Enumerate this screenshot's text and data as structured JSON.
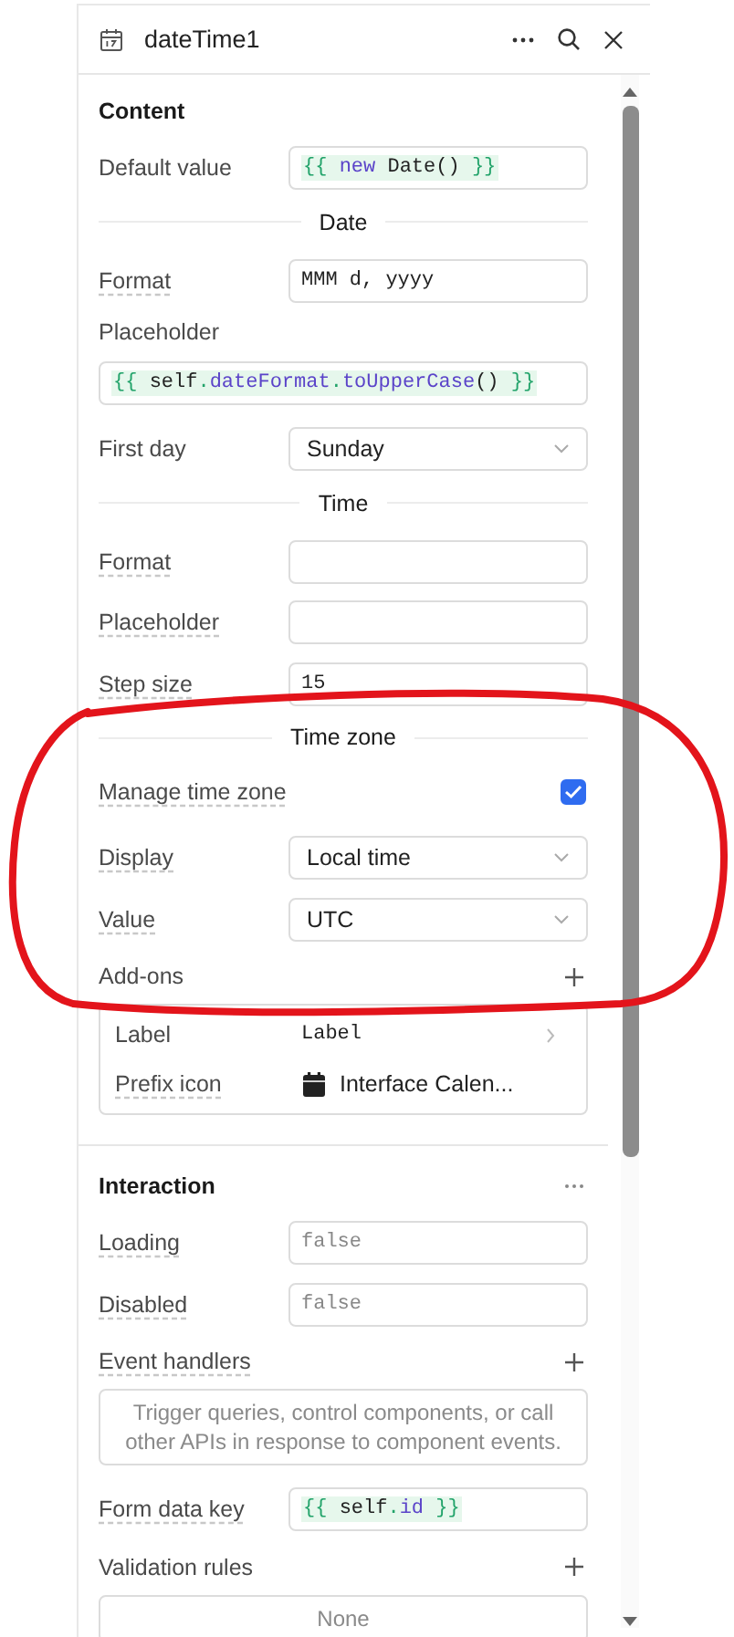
{
  "header": {
    "title": "dateTime1"
  },
  "sections": [
    {
      "title": "Content",
      "menu": false,
      "rows": [
        {
          "kind": "code",
          "label": "Default value",
          "tooltip": false,
          "tokens": [
            {
              "text": "{{ ",
              "kind": "brace"
            },
            {
              "text": "new",
              "kind": "keyword"
            },
            {
              "text": " Date() ",
              "kind": "plain"
            },
            {
              "text": "}}",
              "kind": "brace"
            }
          ]
        },
        {
          "kind": "divider",
          "text": "Date"
        },
        {
          "kind": "input",
          "label": "Format",
          "tooltip": true,
          "value": "MMM d, yyyy"
        },
        {
          "kind": "code_stacked",
          "label": "Placeholder",
          "tooltip": false,
          "tokens": [
            {
              "text": "{{ ",
              "kind": "brace"
            },
            {
              "text": "self",
              "kind": "plain"
            },
            {
              "text": ".",
              "kind": "brace"
            },
            {
              "text": "dateFormat",
              "kind": "keyword"
            },
            {
              "text": ".",
              "kind": "brace"
            },
            {
              "text": "toUpperCase",
              "kind": "keyword"
            },
            {
              "text": "() ",
              "kind": "plain"
            },
            {
              "text": "}}",
              "kind": "brace"
            }
          ]
        },
        {
          "kind": "select",
          "label": "First day",
          "tooltip": false,
          "value": "Sunday"
        },
        {
          "kind": "divider",
          "text": "Time"
        },
        {
          "kind": "input",
          "label": "Format",
          "tooltip": true
        },
        {
          "kind": "input",
          "label": "Placeholder",
          "tooltip": true
        },
        {
          "kind": "input",
          "label": "Step size",
          "tooltip": true,
          "value": "15"
        },
        {
          "kind": "divider",
          "text": "Time zone"
        },
        {
          "kind": "checkbox",
          "label": "Manage time zone",
          "tooltip": true,
          "checked": true
        },
        {
          "kind": "select",
          "label": "Display",
          "tooltip": true,
          "value": "Local time"
        },
        {
          "kind": "select",
          "label": "Value",
          "tooltip": true,
          "value": "UTC"
        },
        {
          "kind": "list_header",
          "label": "Add-ons",
          "tooltip": false
        },
        {
          "kind": "addons",
          "items": [
            {
              "label": "Label",
              "tooltip": false,
              "value": "Label",
              "kind": "text"
            },
            {
              "label": "Prefix icon",
              "tooltip": true,
              "value": "Interface Calen...",
              "kind": "icon"
            }
          ]
        }
      ]
    },
    {
      "title": "Interaction",
      "menu": true,
      "rows": [
        {
          "kind": "input",
          "label": "Loading",
          "tooltip": true,
          "placeholder": "false"
        },
        {
          "kind": "input",
          "label": "Disabled",
          "tooltip": true,
          "placeholder": "false"
        },
        {
          "kind": "list_header",
          "label": "Event handlers",
          "tooltip": true
        },
        {
          "kind": "empty_box",
          "text": "Trigger queries, control components, or call other APIs in response to component events."
        },
        {
          "kind": "code",
          "label": "Form data key",
          "tooltip": true,
          "tokens": [
            {
              "text": "{{ ",
              "kind": "brace"
            },
            {
              "text": "self",
              "kind": "plain"
            },
            {
              "text": ".",
              "kind": "brace"
            },
            {
              "text": "id",
              "kind": "keyword"
            },
            {
              "text": " }}",
              "kind": "brace"
            }
          ]
        },
        {
          "kind": "list_header",
          "label": "Validation rules",
          "tooltip": false
        },
        {
          "kind": "empty_box",
          "text": "None"
        }
      ]
    }
  ]
}
